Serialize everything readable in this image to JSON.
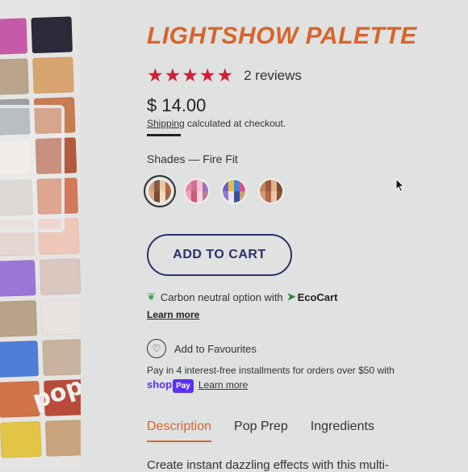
{
  "product": {
    "title": "LIGHTSHOW PALETTE",
    "rating": 5,
    "stars": "★★★★★",
    "reviews": "2 reviews",
    "price": "$ 14.00",
    "shipping_link": "Shipping",
    "shipping_rest": " calculated at checkout.",
    "shades_label": "Shades — Fire Fit"
  },
  "colors": {
    "accent": "#d9642d",
    "stars": "#d21f36",
    "cta": "#2f2d6a",
    "shop_pay": "#5a31f4"
  },
  "actions": {
    "add_to_cart": "ADD TO CART"
  },
  "carbon": {
    "text": "Carbon neutral option with",
    "brand": "EcoCart",
    "learn_more": "Learn more"
  },
  "favourites": {
    "label": "Add to Favourites"
  },
  "installments": {
    "text": "Pay in 4 interest-free installments for orders over $50 with",
    "shop": "shop",
    "pay": "Pay",
    "learn_more": "Learn more"
  },
  "tabs": [
    {
      "label": "Description",
      "active": true
    },
    {
      "label": "Pop Prep",
      "active": false
    },
    {
      "label": "Ingredients",
      "active": false
    }
  ],
  "description_preview": "Create instant dazzling effects with this multi-",
  "brand_mark": "pop"
}
